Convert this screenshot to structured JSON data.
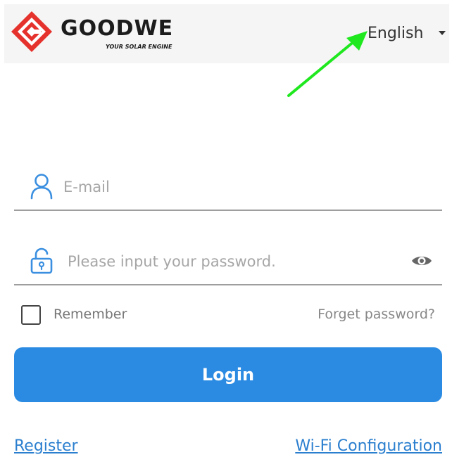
{
  "header": {
    "brand_name": "GOODWE",
    "brand_tagline": "YOUR SOLAR ENGINE",
    "language": "English",
    "colors": {
      "brand_red": "#e5322d",
      "background": "#f5f5f5"
    }
  },
  "login_form": {
    "email": {
      "value": "",
      "placeholder": "E-mail",
      "icon": "user-icon"
    },
    "password": {
      "value": "",
      "placeholder": "Please input your password.",
      "icon": "lock-icon",
      "toggle_icon": "eye-icon"
    },
    "remember_label": "Remember",
    "remember_checked": false,
    "forget_label": "Forget password?",
    "login_label": "Login",
    "colors": {
      "primary": "#2b8be2",
      "icon": "#3a8fe0"
    }
  },
  "footer": {
    "register_label": "Register",
    "wifi_label": "Wi-Fi Configuration"
  },
  "annotation": {
    "arrow_color": "#1fe81f"
  }
}
